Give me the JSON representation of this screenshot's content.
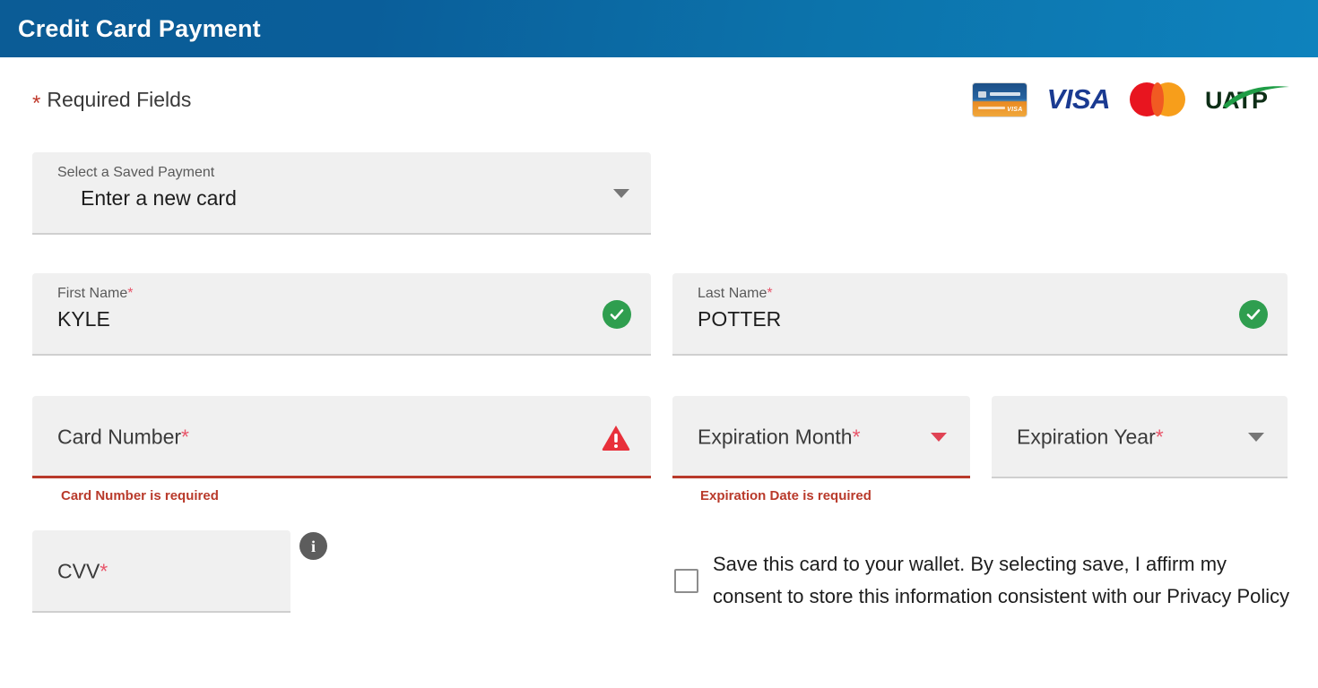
{
  "header": {
    "title": "Credit Card Payment",
    "bg_from": "#0b5c96",
    "bg_to": "#0e82bd"
  },
  "required_note": {
    "asterisk": "*",
    "text": "Required Fields",
    "asterisk_color": "#c0392b"
  },
  "accepted_cards": [
    {
      "name": "card-image-logo",
      "label": "Credit Card"
    },
    {
      "name": "visa-logo",
      "label": "VISA"
    },
    {
      "name": "mastercard-logo",
      "label": "Mastercard"
    },
    {
      "name": "uatp-logo",
      "label": "UATP"
    }
  ],
  "saved_payment": {
    "label": "Select a Saved Payment",
    "value": "Enter a new card",
    "caret": "chevron-down-icon"
  },
  "first_name": {
    "label": "First Name",
    "required_mark": "*",
    "value": "KYLE",
    "status": "valid",
    "status_icon": "check-circle-icon",
    "status_color": "#2f9e4f"
  },
  "last_name": {
    "label": "Last Name",
    "required_mark": "*",
    "value": "POTTER",
    "status": "valid",
    "status_icon": "check-circle-icon",
    "status_color": "#2f9e4f"
  },
  "card_number": {
    "label": "Card Number",
    "required_mark": "*",
    "value": "",
    "status": "error",
    "status_icon": "warning-triangle-icon",
    "status_color": "#e8303a",
    "error_message": "Card Number is required",
    "error_color": "#b93a2b"
  },
  "expiration_month": {
    "label": "Expiration Month",
    "required_mark": "*",
    "value": "",
    "status": "error",
    "caret": "chevron-down-icon",
    "caret_color": "#e04354",
    "error_message": "Expiration Date is required",
    "error_color": "#b93a2b"
  },
  "expiration_year": {
    "label": "Expiration Year",
    "required_mark": "*",
    "value": "",
    "status": "default",
    "caret": "chevron-down-icon",
    "caret_color": "#767676"
  },
  "cvv": {
    "label": "CVV",
    "required_mark": "*",
    "value": "",
    "info_icon": "info-circle-icon",
    "info_glyph": "i"
  },
  "save_card_consent": {
    "checked": false,
    "text": "Save this card to your wallet. By selecting save, I affirm my consent to store this information consistent with our Privacy Policy"
  }
}
